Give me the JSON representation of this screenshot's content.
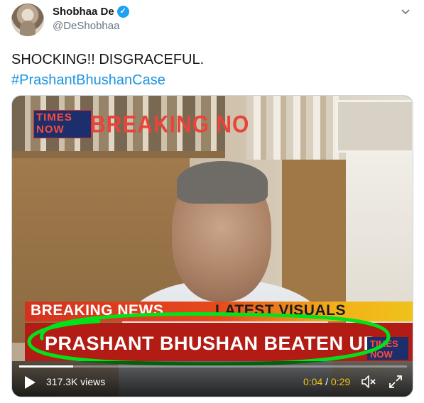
{
  "author": {
    "display_name": "Shobhaa De",
    "handle": "@DeShobhaa",
    "verified_icon": "verified-badge-icon",
    "verified_color": "#1da1f2"
  },
  "tweet": {
    "text_line1": "SHOCKING!! DISGRACEFUL.",
    "hashtag": "#PrashantBhushanCase",
    "hashtag_color": "#1b95e0"
  },
  "video": {
    "channel_logo_line1": "TIMES",
    "channel_logo_line2": "NOW",
    "banner": "BREAKING NO",
    "ticker_left": "BREAKING NEWS",
    "ticker_right": "LATEST VISUALS",
    "headline": "PRASHANT BHUSHAN BEATEN UP",
    "ticker_logo_line1": "TIMES",
    "ticker_logo_line2": "NOW",
    "annotation_color": "#00e31a",
    "controls": {
      "views": "317.3K views",
      "current_time": "0:04",
      "separator": "/",
      "total_time": "0:29",
      "progress": 0.14,
      "play_icon": "play-icon",
      "volume_icon": "volume-icon",
      "fullscreen_icon": "fullscreen-icon",
      "time_color": "#f0c419"
    }
  }
}
